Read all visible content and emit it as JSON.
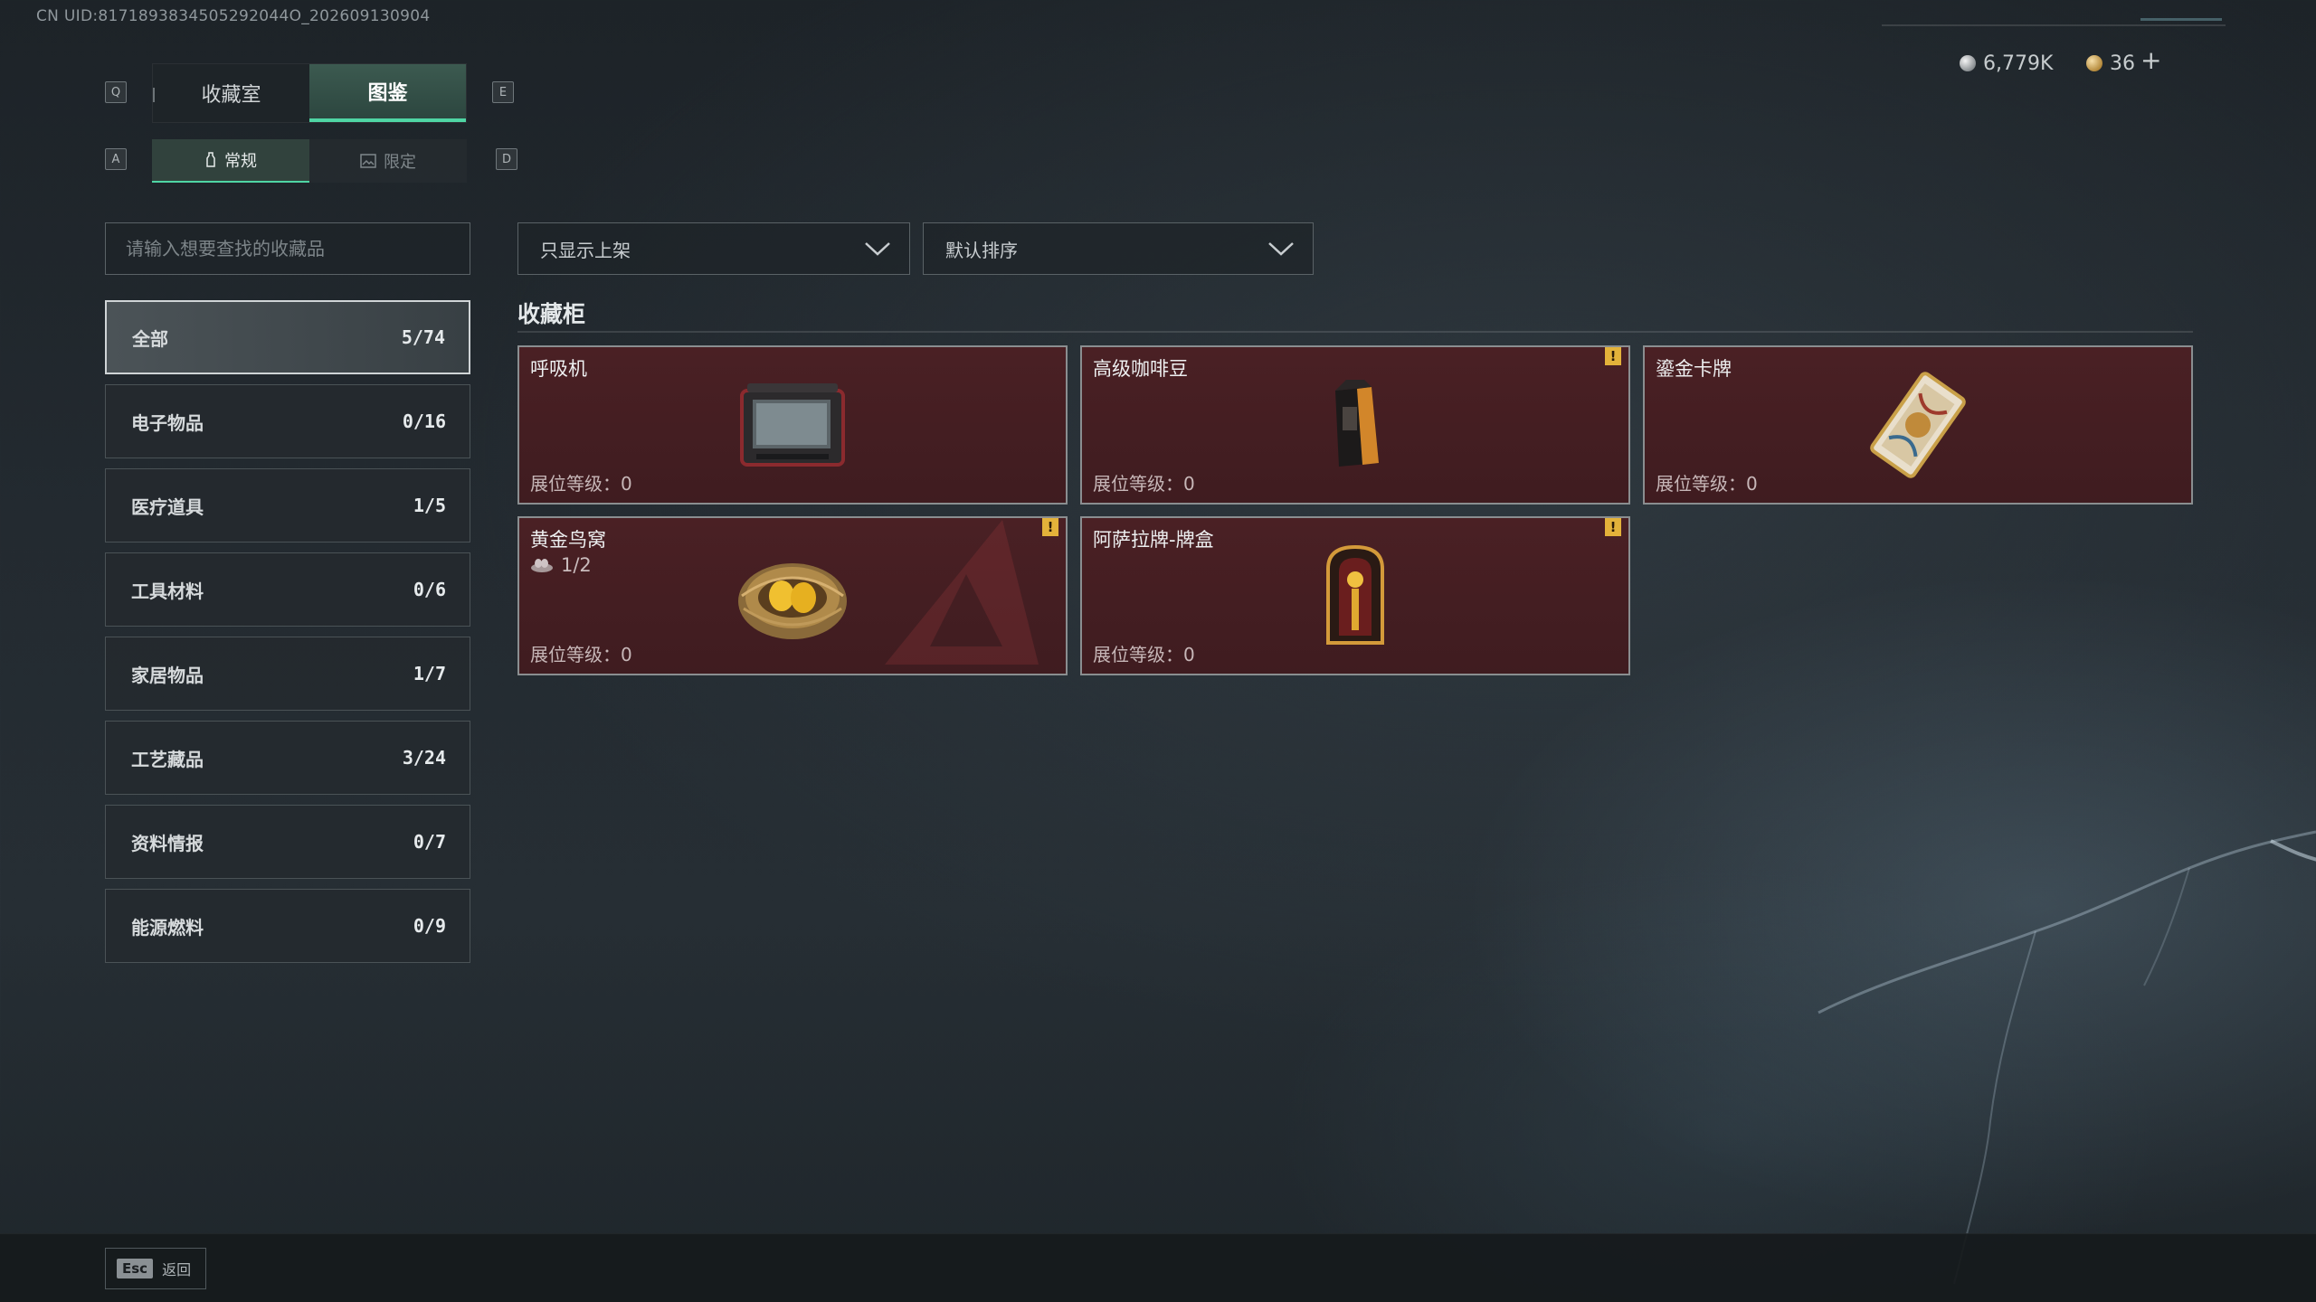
{
  "uid_text": "CN UID:8171893834505292044O_202609130904",
  "currency": {
    "silver": "6,779K",
    "gold": "36",
    "add_symbol": "+"
  },
  "keys": {
    "prev_tab": "Q",
    "next_tab": "E",
    "prev_sub": "A",
    "next_sub": "D"
  },
  "tabs": [
    {
      "label": "收藏室",
      "active": false
    },
    {
      "label": "图鉴",
      "active": true
    }
  ],
  "subtabs": [
    {
      "label": "常规",
      "active": true
    },
    {
      "label": "限定",
      "active": false
    }
  ],
  "search": {
    "placeholder": "请输入想要查找的收藏品",
    "value": ""
  },
  "categories": [
    {
      "label": "全部",
      "count": "5/74",
      "active": true
    },
    {
      "label": "电子物品",
      "count": "0/16"
    },
    {
      "label": "医疗道具",
      "count": "1/5"
    },
    {
      "label": "工具材料",
      "count": "0/6"
    },
    {
      "label": "家居物品",
      "count": "1/7"
    },
    {
      "label": "工艺藏品",
      "count": "3/24"
    },
    {
      "label": "资料情报",
      "count": "0/7"
    },
    {
      "label": "能源燃料",
      "count": "0/9"
    }
  ],
  "filters": {
    "shelf": "只显示上架",
    "sort": "默认排序"
  },
  "section_title": "收藏柜",
  "items": [
    {
      "name": "呼吸机",
      "level": "展位等级：0",
      "warn": false,
      "icon": "ventilator-icon"
    },
    {
      "name": "高级咖啡豆",
      "level": "展位等级：0",
      "warn": true,
      "icon": "coffee-bag-icon"
    },
    {
      "name": "鎏金卡牌",
      "level": "展位等级：0",
      "warn": false,
      "icon": "gilded-card-icon"
    },
    {
      "name": "黄金鸟窝",
      "level": "展位等级：0",
      "warn": true,
      "progress": "1/2",
      "icon": "golden-nest-icon"
    },
    {
      "name": "阿萨拉牌-牌盒",
      "level": "展位等级：0",
      "warn": true,
      "icon": "card-box-icon"
    }
  ],
  "warn_symbol": "!",
  "footer": {
    "key": "Esc",
    "label": "返回"
  },
  "colors": {
    "accent": "#4fd5a4",
    "card_bg": "#4a2024",
    "warning": "#e3b23a"
  }
}
